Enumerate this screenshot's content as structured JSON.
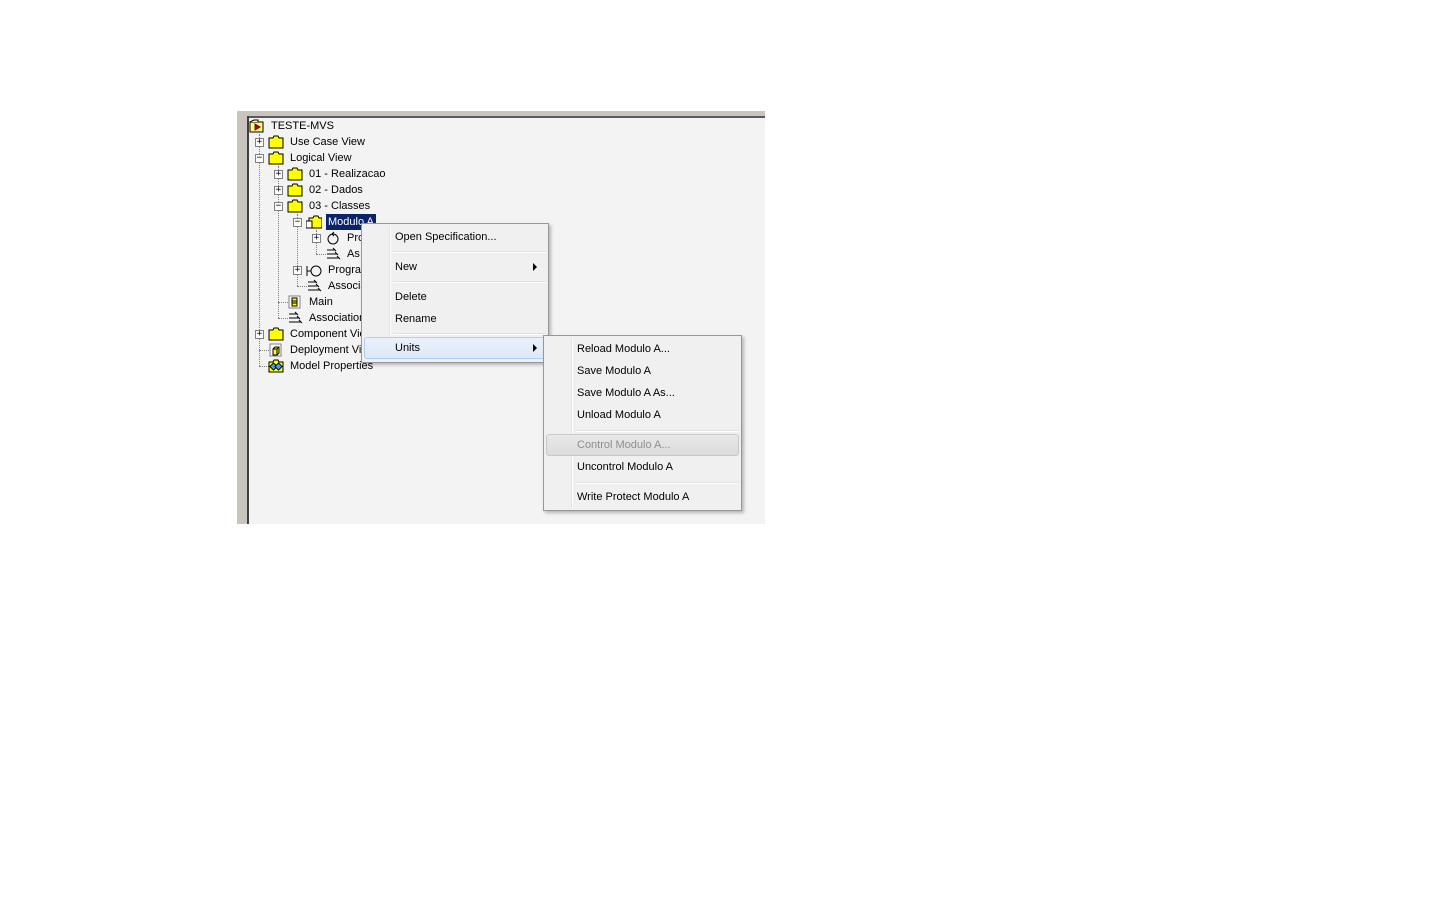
{
  "tree": {
    "root": {
      "label": "TESTE-MVS",
      "icon": "model-icon"
    },
    "nodes": [
      {
        "label": "Use Case View",
        "icon": "folder-icon",
        "expander": "+"
      },
      {
        "label": "Logical View",
        "icon": "folder-icon",
        "expander": "-"
      },
      {
        "label": "01 - Realizacao",
        "icon": "folder-icon",
        "expander": "+"
      },
      {
        "label": "02 - Dados",
        "icon": "folder-icon",
        "expander": "+"
      },
      {
        "label": "03 - Classes",
        "icon": "folder-icon",
        "expander": "-"
      },
      {
        "label": "Modulo A",
        "icon": "controlled-package-icon",
        "expander": "-",
        "selected": true
      },
      {
        "label": "Pro",
        "icon": "control-class-icon",
        "expander": "+"
      },
      {
        "label": "As",
        "icon": "association-icon"
      },
      {
        "label": "Progra",
        "icon": "interface-class-icon",
        "expander": "+"
      },
      {
        "label": "Associa",
        "icon": "association-icon"
      },
      {
        "label": "Main",
        "icon": "class-diagram-icon"
      },
      {
        "label": "Association",
        "icon": "association-icon"
      },
      {
        "label": "Component Vie",
        "icon": "folder-icon",
        "expander": "+"
      },
      {
        "label": "Deployment Vie",
        "icon": "deployment-icon"
      },
      {
        "label": "Model Properties",
        "icon": "properties-icon"
      }
    ]
  },
  "context_menu": {
    "items": [
      {
        "label": "Open Specification..."
      },
      {
        "label": "New",
        "submenu": true
      },
      {
        "label": "Delete"
      },
      {
        "label": "Rename"
      },
      {
        "label": "Units",
        "submenu": true,
        "highlighted": true
      }
    ]
  },
  "units_submenu": {
    "items": [
      {
        "label": "Reload Modulo A..."
      },
      {
        "label": "Save Modulo A"
      },
      {
        "label": "Save Modulo A As..."
      },
      {
        "label": "Unload Modulo A"
      },
      {
        "label": "Control Modulo A...",
        "disabled": true
      },
      {
        "label": "Uncontrol Modulo A"
      },
      {
        "label": "Write Protect Modulo A"
      }
    ]
  },
  "colors": {
    "selection": "#0a246a",
    "folder": "#ffff00",
    "menu_bg": "#f0f0f0",
    "menu_highlight": "#dde8f8"
  }
}
